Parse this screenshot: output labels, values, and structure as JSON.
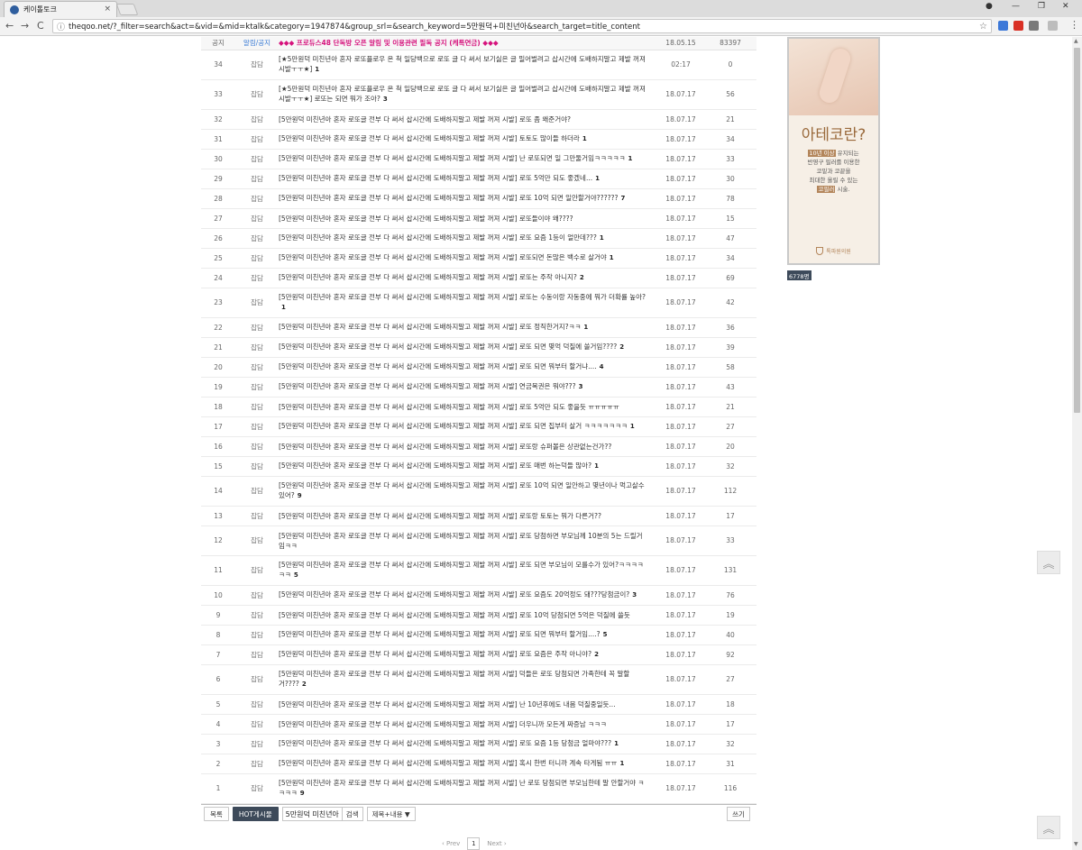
{
  "browser": {
    "tab_title": "케이톨토크",
    "tab_close": "×",
    "url": "theqoo.net/?_filter=search&act=&vid=&mid=ktalk&category=1947874&group_srl=&search_keyword=5만원덕+미친년아&search_target=title_content",
    "back": "←",
    "forward": "→",
    "reload": "C",
    "info_icon": "ⓘ",
    "star": "☆",
    "menu": "⋮",
    "win_min": "—",
    "win_max": "❐",
    "win_close": "✕",
    "profile": "●"
  },
  "notice": {
    "label": "공지",
    "category": "알림/공지",
    "title": "◆◆◆ 프로듀스48 단독방 오픈 알림 및 이용관련 필독 공지 (케톡연금) ◆◆◆",
    "date": "18.05.15",
    "views": "83397"
  },
  "rows": [
    {
      "no": "34",
      "cat": "잡담",
      "title": "[★5만원덕 미친년아 혼자 로또플로우 온 척 일당백으로 로또 글 다 써서 보기싫은 글 밀어벌려고 삽시간에 도배하지말고 제발 꺼져 시발ㅜㅜ★]",
      "c": "1",
      "date": "02:17",
      "views": "0"
    },
    {
      "no": "33",
      "cat": "잡담",
      "title": "[★5만원덕 미친년아 혼자 로또플로우 온 척 일당백으로 로또 글 다 써서 보기싫은 글 밀어벌려고 삽시간에 도배하지말고 제발 꺼져 시발ㅜㅜ★] 로또는 되면 뭐가 조아?",
      "c": "3",
      "date": "18.07.17",
      "views": "56"
    },
    {
      "no": "32",
      "cat": "잡담",
      "title": "[5만원덕 미친년아 혼자 로또글 전부 다 써서 삽시간에 도배하지말고 제발 꺼져 시발] 로또 좀 왜준거야?",
      "c": "",
      "date": "18.07.17",
      "views": "21"
    },
    {
      "no": "31",
      "cat": "잡담",
      "title": "[5만원덕 미친년아 혼자 로또글 전부 다 써서 삽시간에 도배하지말고 제발 꺼져 시발] 토토도 많이들 하더라",
      "c": "1",
      "date": "18.07.17",
      "views": "34"
    },
    {
      "no": "30",
      "cat": "잡담",
      "title": "[5만원덕 미친년아 혼자 로또글 전부 다 써서 삽시간에 도배하지말고 제발 꺼져 시발] 난 로또되면 일 그만둘거임ㅋㅋㅋㅋㅋ",
      "c": "1",
      "date": "18.07.17",
      "views": "33"
    },
    {
      "no": "29",
      "cat": "잡담",
      "title": "[5만원덕 미친년아 혼자 로또글 전부 다 써서 삽시간에 도배하지말고 제발 꺼져 시발] 로또 5억만 되도 좋겠네...",
      "c": "1",
      "date": "18.07.17",
      "views": "30"
    },
    {
      "no": "28",
      "cat": "잡담",
      "title": "[5만원덕 미친년아 혼자 로또글 전부 다 써서 삽시간에 도배하지말고 제발 꺼져 시발] 로또 10억 되면 일안할거야??????",
      "c": "7",
      "date": "18.07.17",
      "views": "78"
    },
    {
      "no": "27",
      "cat": "잡담",
      "title": "[5만원덕 미친년아 혼자 로또글 전부 다 써서 삽시간에 도배하지말고 제발 꺼져 시발] 로또들이야 왜????",
      "c": "",
      "date": "18.07.17",
      "views": "15"
    },
    {
      "no": "26",
      "cat": "잡담",
      "title": "[5만원덕 미친년아 혼자 로또글 전부 다 써서 삽시간에 도배하지말고 제발 꺼져 시발] 로또 요즘 1등이 얼만데???",
      "c": "1",
      "date": "18.07.17",
      "views": "47"
    },
    {
      "no": "25",
      "cat": "잡담",
      "title": "[5만원덕 미친년아 혼자 로또글 전부 다 써서 삽시간에 도배하지말고 제발 꺼져 시발] 로또되면 돈많은 백수로 살거야",
      "c": "1",
      "date": "18.07.17",
      "views": "34"
    },
    {
      "no": "24",
      "cat": "잡담",
      "title": "[5만원덕 미친년아 혼자 로또글 전부 다 써서 삽시간에 도배하지말고 제발 꺼져 시발] 로또는 주작 아니지?",
      "c": "2",
      "date": "18.07.17",
      "views": "69"
    },
    {
      "no": "23",
      "cat": "잡담",
      "title": "[5만원덕 미친년아 혼자 로또글 전부 다 써서 삽시간에 도배하지말고 제발 꺼져 시발] 로또는 수동이랑 자동중에 뭐가 더확률 높아?",
      "c": "1",
      "date": "18.07.17",
      "views": "42"
    },
    {
      "no": "22",
      "cat": "잡담",
      "title": "[5만원덕 미친년아 혼자 로또글 전부 다 써서 삽시간에 도배하지말고 제발 꺼져 시발] 로또 정직한거지?ㅋㅋ",
      "c": "1",
      "date": "18.07.17",
      "views": "36"
    },
    {
      "no": "21",
      "cat": "잡담",
      "title": "[5만원덕 미친년아 혼자 로또글 전부 다 써서 삽시간에 도배하지말고 제발 꺼져 시발] 로또 되면 몇억 덕질에 쓸거임????",
      "c": "2",
      "date": "18.07.17",
      "views": "39"
    },
    {
      "no": "20",
      "cat": "잡담",
      "title": "[5만원덕 미친년아 혼자 로또글 전부 다 써서 삽시간에 도배하지말고 제발 꺼져 시발] 로또 되면 뭐부터 할거냐....",
      "c": "4",
      "date": "18.07.17",
      "views": "58"
    },
    {
      "no": "19",
      "cat": "잡담",
      "title": "[5만원덕 미친년아 혼자 로또글 전부 다 써서 삽시간에 도배하지말고 제발 꺼져 시발] 연금복권은 뭐야???",
      "c": "3",
      "date": "18.07.17",
      "views": "43"
    },
    {
      "no": "18",
      "cat": "잡담",
      "title": "[5만원덕 미친년아 혼자 로또글 전부 다 써서 삽시간에 도배하지말고 제발 꺼져 시발] 로또 5억만 되도 좋을듯 ㅠㅠㅠㅠㅠ",
      "c": "",
      "date": "18.07.17",
      "views": "21"
    },
    {
      "no": "17",
      "cat": "잡담",
      "title": "[5만원덕 미친년아 혼자 로또글 전부 다 써서 삽시간에 도배하지말고 제발 꺼져 시발] 로또 되면 집부터 살거 ㅋㅋㅋㅋㅋㅋㅋ",
      "c": "1",
      "date": "18.07.17",
      "views": "27"
    },
    {
      "no": "16",
      "cat": "잡담",
      "title": "[5만원덕 미친년아 혼자 로또글 전부 다 써서 삽시간에 도배하지말고 제발 꺼져 시발] 로또랑 슈퍼볼은 상관없는건가??",
      "c": "",
      "date": "18.07.17",
      "views": "20"
    },
    {
      "no": "15",
      "cat": "잡담",
      "title": "[5만원덕 미친년아 혼자 로또글 전부 다 써서 삽시간에 도배하지말고 제발 꺼져 시발] 로또 매번 하는덕들 많아?",
      "c": "1",
      "date": "18.07.17",
      "views": "32"
    },
    {
      "no": "14",
      "cat": "잡담",
      "title": "[5만원덕 미친년아 혼자 로또글 전부 다 써서 삽시간에 도배하지말고 제발 꺼져 시발] 로또 10억 되면 일안하고 몇년이나 먹고살수 있어?",
      "c": "9",
      "date": "18.07.17",
      "views": "112"
    },
    {
      "no": "13",
      "cat": "잡담",
      "title": "[5만원덕 미친년아 혼자 로또글 전부 다 써서 삽시간에 도배하지말고 제발 꺼져 시발] 로또랑 토토는 뭐가 다른거??",
      "c": "",
      "date": "18.07.17",
      "views": "17"
    },
    {
      "no": "12",
      "cat": "잡담",
      "title": "[5만원덕 미친년아 혼자 로또글 전부 다 써서 삽시간에 도배하지말고 제발 꺼져 시발] 로또 당첨하면 부모님께 10분의 5는 드릴거임ㅋㅋ",
      "c": "",
      "date": "18.07.17",
      "views": "33"
    },
    {
      "no": "11",
      "cat": "잡담",
      "title": "[5만원덕 미친년아 혼자 로또글 전부 다 써서 삽시간에 도배하지말고 제발 꺼져 시발] 로또 되면 부모님이 모를수가 있어?ㅋㅋㅋㅋㅋㅋ",
      "c": "5",
      "date": "18.07.17",
      "views": "131"
    },
    {
      "no": "10",
      "cat": "잡담",
      "title": "[5만원덕 미친년아 혼자 로또글 전부 다 써서 삽시간에 도배하지말고 제발 꺼져 시발] 로또 요즘도 20억정도 돼???당첨금이?",
      "c": "3",
      "date": "18.07.17",
      "views": "76"
    },
    {
      "no": "9",
      "cat": "잡담",
      "title": "[5만원덕 미친년아 혼자 로또글 전부 다 써서 삽시간에 도배하지말고 제발 꺼져 시발] 로또 10억 당첨되면 5억은 덕질에 쓸듯",
      "c": "",
      "date": "18.07.17",
      "views": "19"
    },
    {
      "no": "8",
      "cat": "잡담",
      "title": "[5만원덕 미친년아 혼자 로또글 전부 다 써서 삽시간에 도배하지말고 제발 꺼져 시발] 로또 되면 뭐부터 할거임....?",
      "c": "5",
      "date": "18.07.17",
      "views": "40"
    },
    {
      "no": "7",
      "cat": "잡담",
      "title": "[5만원덕 미친년아 혼자 로또글 전부 다 써서 삽시간에 도배하지말고 제발 꺼져 시발] 로또 요즘은 주작 아니야?",
      "c": "2",
      "date": "18.07.17",
      "views": "92"
    },
    {
      "no": "6",
      "cat": "잡담",
      "title": "[5만원덕 미친년아 혼자 로또글 전부 다 써서 삽시간에 도배하지말고 제발 꺼져 시발] 덕들은 로또 당첨되면 가족한테 꼭 말할거????",
      "c": "2",
      "date": "18.07.17",
      "views": "27"
    },
    {
      "no": "5",
      "cat": "잡담",
      "title": "[5만원덕 미친년아 혼자 로또글 전부 다 써서 삽시간에 도배하지말고 제발 꺼져 시발] 난 10년후에도 내몸 덕질중일듯...",
      "c": "",
      "date": "18.07.17",
      "views": "18"
    },
    {
      "no": "4",
      "cat": "잡담",
      "title": "[5만원덕 미친년아 혼자 로또글 전부 다 써서 삽시간에 도배하지말고 제발 꺼져 시발] 더우니까 모든게 짜증남 ㅋㅋㅋ",
      "c": "",
      "date": "18.07.17",
      "views": "17"
    },
    {
      "no": "3",
      "cat": "잡담",
      "title": "[5만원덕 미친년아 혼자 로또글 전부 다 써서 삽시간에 도배하지말고 제발 꺼져 시발] 로또 요즘 1등 당첨금 얼마야???",
      "c": "1",
      "date": "18.07.17",
      "views": "32"
    },
    {
      "no": "2",
      "cat": "잡담",
      "title": "[5만원덕 미친년아 혼자 로또글 전부 다 써서 삽시간에 도배하지말고 제발 꺼져 시발] 혹시 한번 터니까 계속 타게됨 ㅠㅠ",
      "c": "1",
      "date": "18.07.17",
      "views": "31"
    },
    {
      "no": "1",
      "cat": "잡담",
      "title": "[5만원덕 미친년아 혼자 로또글 전부 다 써서 삽시간에 도배하지말고 제발 꺼져 시발] 난 로또 당첨되면 부모님한테 말 안할거야 ㅋㅋㅋㅋ",
      "c": "9",
      "date": "18.07.17",
      "views": "116"
    }
  ],
  "controls": {
    "list": "목록",
    "hot": "HOT게시물",
    "keyword": "5만원덕 미친년아",
    "search": "검색",
    "target": "제목+내용 ▼",
    "write": "쓰기"
  },
  "pager": {
    "prev": "‹ Prev",
    "current": "1",
    "next": "Next ›"
  },
  "ad": {
    "headline": "아테코란?",
    "years_hl": "10년 이상",
    "line1": " 유지되는",
    "line2": "반영구 필러를 이용한",
    "line3": "코밑과 코끝을",
    "line4": "최대한 올릴 수 있는",
    "tech_hl": "코필러",
    "line5": " 시술.",
    "clinic": "톡파원의원"
  },
  "counter": "6778명",
  "top_icon": "︽"
}
